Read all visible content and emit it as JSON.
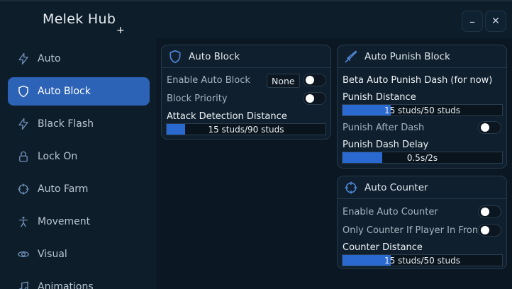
{
  "app": {
    "title": "Melek Hub",
    "cursor_glyph": "+",
    "minimize_glyph": "–",
    "close_glyph": "✕"
  },
  "sidebar": {
    "items": [
      {
        "label": "Auto",
        "icon": "lightning-icon",
        "active": false
      },
      {
        "label": "Auto Block",
        "icon": "shield-icon",
        "active": true
      },
      {
        "label": "Black Flash",
        "icon": "lightning-icon",
        "active": false
      },
      {
        "label": "Lock On",
        "icon": "lock-icon",
        "active": false
      },
      {
        "label": "Auto Farm",
        "icon": "crosshair-icon",
        "active": false
      },
      {
        "label": "Movement",
        "icon": "person-icon",
        "active": false
      },
      {
        "label": "Visual",
        "icon": "eye-icon",
        "active": false
      },
      {
        "label": "Animations",
        "icon": "music-icon",
        "active": false
      }
    ]
  },
  "auto_block": {
    "title": "Auto Block",
    "enable_label": "Enable Auto Block",
    "enable_dropdown": "None",
    "enable_on": false,
    "priority_label": "Block Priority",
    "priority_on": false,
    "distance_label": "Attack Detection Distance",
    "distance_value": "15 studs/90 studs",
    "distance_fraction": 0.1167
  },
  "auto_punish": {
    "title": "Auto Punish Block",
    "beta_label": "Beta Auto Punish Dash (for now)",
    "distance_label": "Punish Distance",
    "distance_value": "15 studs/50 studs",
    "distance_fraction": 0.3,
    "after_dash_label": "Punish After Dash",
    "after_dash_on": false,
    "delay_label": "Punish Dash Delay",
    "delay_value": "0.5s/2s",
    "delay_fraction": 0.25
  },
  "auto_counter": {
    "title": "Auto Counter",
    "enable_label": "Enable Auto Counter",
    "enable_on": false,
    "only_label": "Only Counter If Player In Front",
    "only_on": false,
    "distance_label": "Counter Distance",
    "distance_value": "15 studs/50 studs",
    "distance_fraction": 0.3
  },
  "colors": {
    "accent": "#2d63b6",
    "slider_fill": "#2a6ad0",
    "background": "#0d1c29"
  }
}
